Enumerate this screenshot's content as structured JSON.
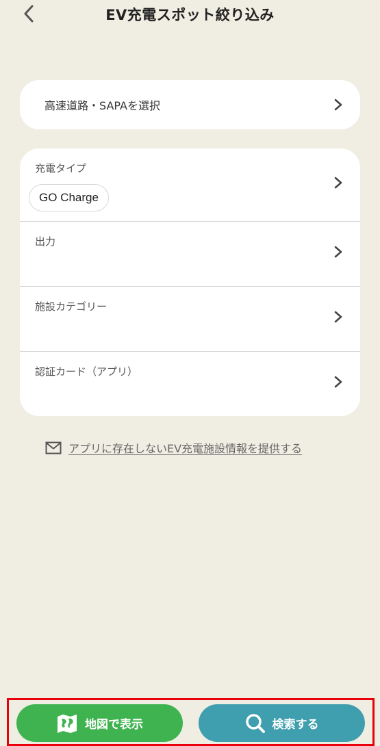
{
  "header": {
    "title": "EV充電スポット絞り込み",
    "back_icon": "chevron-left-icon"
  },
  "highway": {
    "label": "高速道路・SAPAを選択"
  },
  "filters": {
    "charge_type": {
      "label": "充電タイプ",
      "selected_chip": "GO Charge"
    },
    "output": {
      "label": "出力"
    },
    "facility_category": {
      "label": "施設カテゴリー"
    },
    "auth_card": {
      "label": "認証カード（アプリ）"
    }
  },
  "report_link": {
    "icon": "mail-icon",
    "text": "アプリに存在しないEV充電施設情報を提供する"
  },
  "bottom": {
    "map_label": "地図で表示",
    "search_label": "検索する"
  },
  "colors": {
    "background": "#f0ede2",
    "map_button": "#3fb34f",
    "search_button": "#3f9fae",
    "highlight_border": "#e8000b"
  }
}
